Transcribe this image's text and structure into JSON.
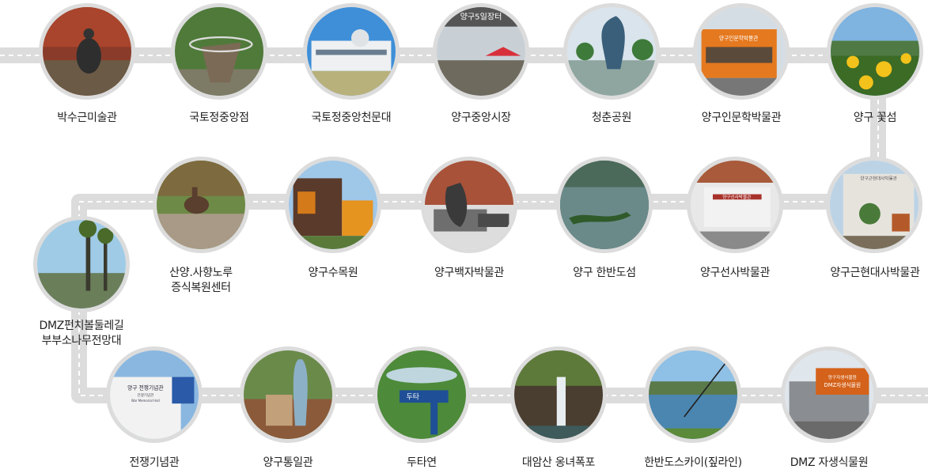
{
  "stops": [
    {
      "name": "박수근미술관"
    },
    {
      "name": "국토정중앙점"
    },
    {
      "name": "국토정중앙천문대"
    },
    {
      "name": "양구중앙시장"
    },
    {
      "name": "청춘공원"
    },
    {
      "name": "양구인문학박물관"
    },
    {
      "name": "양구 꽃섬"
    },
    {
      "name": "양구근현대사박물관"
    },
    {
      "name": "양구선사박물관"
    },
    {
      "name": "양구 한반도섬"
    },
    {
      "name": "양구백자박물관"
    },
    {
      "name": "양구수목원"
    },
    {
      "name_line1": "산양.사향노루",
      "name_line2": "증식복원센터"
    },
    {
      "name_line1": "DMZ펀치볼둘레길",
      "name_line2": "부부소나무전망대"
    },
    {
      "name": "전쟁기념관"
    },
    {
      "name": "양구통일관"
    },
    {
      "name": "두타연"
    },
    {
      "name": "대암산 옹녀폭포"
    },
    {
      "name": "한반도스카이(짚라인)"
    },
    {
      "name": "DMZ 자생식물원"
    }
  ],
  "photo_signs": {
    "market_sign": "양구5일장터",
    "humanities_sign": "양구인문학박물관",
    "modern_sign": "양구근현대사박물관",
    "prehistory_sign": "양구선사박물관",
    "war_sign_1": "양구 전쟁기념관",
    "war_sign_2": "전쟁기념관",
    "war_sign_3": "War Memorial Hall",
    "dutayeon_sign": "두타",
    "wildflower_sign_1": "양구자생식물원",
    "wildflower_sign_2": "DMZ자생식물원"
  },
  "colors": {
    "route": "#dcdcdc",
    "dash": "#ffffff",
    "text": "#222222"
  }
}
